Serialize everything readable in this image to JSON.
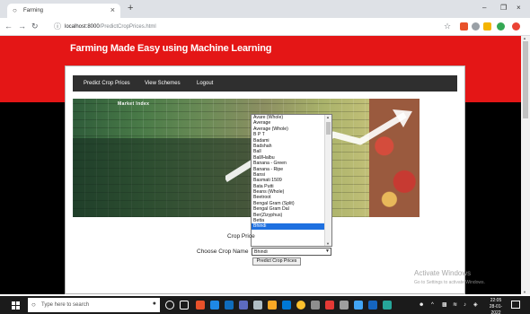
{
  "browser": {
    "tab_title": "Farming",
    "tab_favicon": "globe-icon",
    "url_host": "localhost:8000",
    "url_path": "/PredictCropPrices.html"
  },
  "site": {
    "title": "Farming Made Easy using Machine Learning",
    "nav": [
      "Predict Crop Prices",
      "View Schemes",
      "Logout"
    ]
  },
  "banner": {
    "market_label": "Market Index"
  },
  "dropdown": {
    "options": [
      "Avare (Whole)",
      "Average",
      "Average (Whole)",
      "B P T",
      "Badami",
      "Badshah",
      "Ball",
      "Ball/Halbu",
      "Banana - Green",
      "Banana - Ripe",
      "Bansi",
      "Basmati 1509",
      "Bata Putti",
      "Beans (Whole)",
      "Beetroot",
      "Bengal Gram (Split)",
      "Bengal Gram Dal",
      "Ber(Zizyphus)",
      "Betta",
      "Bhindi"
    ],
    "selected": "Bhindi"
  },
  "form": {
    "price_label": "Crop Price",
    "crop_label": "Choose Crop Name",
    "crop_value": "Bhindi",
    "submit_label": "Predict Crop Prices"
  },
  "watermark": {
    "line1": "Activate Windows",
    "line2": "Go to Settings to activate Windows."
  },
  "taskbar": {
    "search_placeholder": "Type here to search",
    "time": "22:05",
    "date": "28-01-2022"
  }
}
